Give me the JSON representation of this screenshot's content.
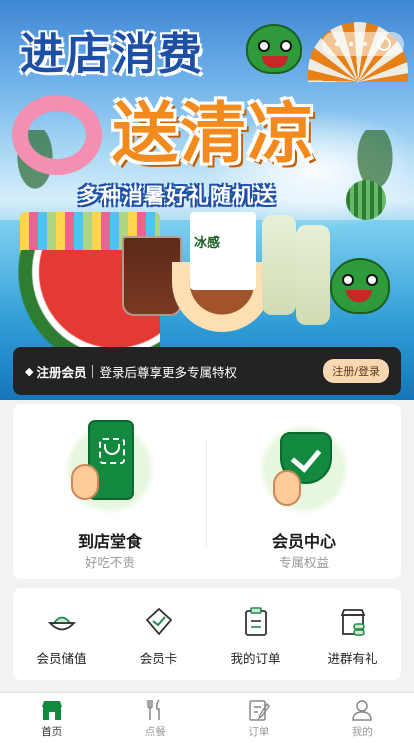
{
  "banner": {
    "title_line1": "进店消费",
    "title_line2": "送清凉",
    "subtitle": "多种消暑好礼随机送",
    "product_label": "冰感"
  },
  "member_bar": {
    "register_label": "注册会员",
    "promo_text": "登录后尊享更多专属特权",
    "login_button": "注册/登录"
  },
  "services": [
    {
      "label": "到店堂食",
      "sub": "好吃不贵",
      "icon": "phone-scan-icon"
    },
    {
      "label": "会员中心",
      "sub": "专属权益",
      "icon": "shield-check-icon"
    }
  ],
  "quick_links": [
    {
      "label": "会员储值",
      "icon": "bowl-icon"
    },
    {
      "label": "会员卡",
      "icon": "card-check-icon"
    },
    {
      "label": "我的订单",
      "icon": "clipboard-icon"
    },
    {
      "label": "进群有礼",
      "icon": "store-group-icon"
    }
  ],
  "tabbar": {
    "items": [
      {
        "label": "首页",
        "icon": "home-icon",
        "active": true
      },
      {
        "label": "点餐",
        "icon": "cutlery-icon",
        "active": false
      },
      {
        "label": "订单",
        "icon": "order-icon",
        "active": false
      },
      {
        "label": "我的",
        "icon": "user-icon",
        "active": false
      }
    ]
  },
  "colors": {
    "brand_green": "#12893e",
    "title_blue": "#1d4fa5",
    "title_orange": "#f28a1e",
    "member_bar_bg": "#232323",
    "login_button_bg": "#f9d7b0"
  }
}
